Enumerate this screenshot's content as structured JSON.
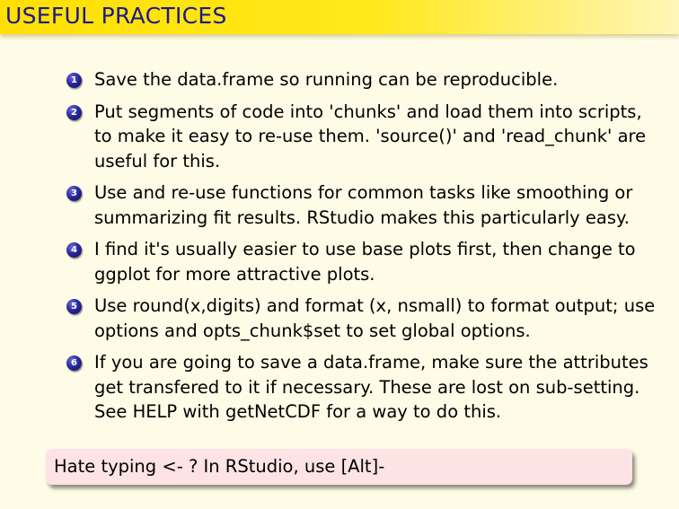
{
  "slide": {
    "title": "USEFUL PRACTICES",
    "items": [
      {
        "number": "1",
        "text": "Save the data.frame so running can be reproducible."
      },
      {
        "number": "2",
        "text": "Put segments of code into 'chunks' and load them into scripts, to make it easy to re-use them. 'source()' and 'read_chunk' are useful for this."
      },
      {
        "number": "3",
        "text": "Use and re-use functions for common tasks like smoothing or summarizing fit results. RStudio makes this particularly easy."
      },
      {
        "number": "4",
        "text": "I find it's usually easier to use base plots first, then change to ggplot for more attractive plots."
      },
      {
        "number": "5",
        "text": "Use round(x,digits) and format (x, nsmall) to format output; use options and opts_chunk$set to set global options."
      },
      {
        "number": "6",
        "text": "If you are going to save a data.frame, make sure the attributes get transfered to it if necessary. These are lost on sub-setting. See HELP with getNetCDF for a way to do this."
      }
    ],
    "note": "Hate typing <- ? In RStudio, use [Alt]-"
  },
  "colors": {
    "title_bar": "#ffe000",
    "title_text": "#1a1a8c",
    "background": "#fefbe6",
    "bullet": "#2a2a9c",
    "note_box": "#fde3e3"
  }
}
